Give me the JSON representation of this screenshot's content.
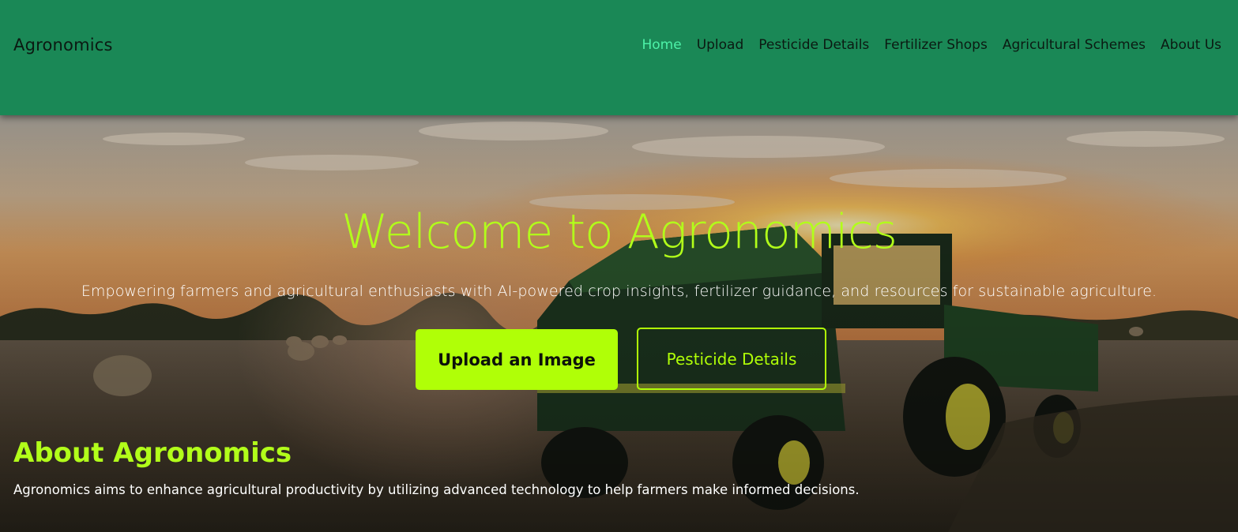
{
  "nav": {
    "brand": "Agronomics",
    "links": [
      "Home",
      "Upload",
      "Pesticide Details",
      "Fertilizer Shops",
      "Agricultural Schemes",
      "About Us"
    ],
    "active_link": "Home"
  },
  "hero": {
    "title": "Welcome to Agronomics",
    "subtitle": "Empowering farmers and agricultural enthusiasts with AI-powered crop insights, fertilizer guidance, and resources for sustainable agriculture.",
    "primary_button": "Upload an Image",
    "secondary_button": "Pesticide Details"
  },
  "about": {
    "title": "About Agronomics",
    "text": "Agronomics aims to enhance agricultural productivity by utilizing advanced technology to help farmers make informed decisions."
  },
  "colors": {
    "header_bg": "#1a8856",
    "accent": "#b0ff07",
    "active_link": "#4df2a8"
  }
}
